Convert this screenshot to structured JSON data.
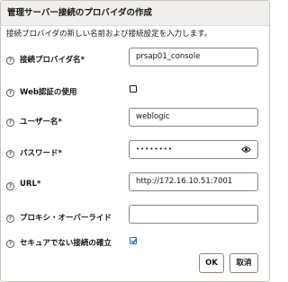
{
  "dialog": {
    "title": "管理サーバー接続のプロバイダの作成",
    "description": "接続プロバイダの新しい名前および接続設定を入力します。",
    "help_icon": "help-circle-icon",
    "fields": {
      "provider_name": {
        "label": "接続プロバイダ名*",
        "value": "prsap01_console"
      },
      "web_auth": {
        "label": "Web認証の使用",
        "checked": false
      },
      "username": {
        "label": "ユーザー名*",
        "value": "weblogic"
      },
      "password": {
        "label": "パスワード*",
        "value": "••••••••",
        "icon": "eye-icon"
      },
      "url": {
        "label": "URL*",
        "value": "http://172.16.10.51:7001"
      },
      "proxy": {
        "label": "プロキシ・オーバーライド",
        "value": ""
      },
      "insecure": {
        "label": "セキュアでない接続の確立",
        "checked": true
      }
    },
    "buttons": {
      "ok": "OK",
      "cancel": "取消"
    }
  }
}
